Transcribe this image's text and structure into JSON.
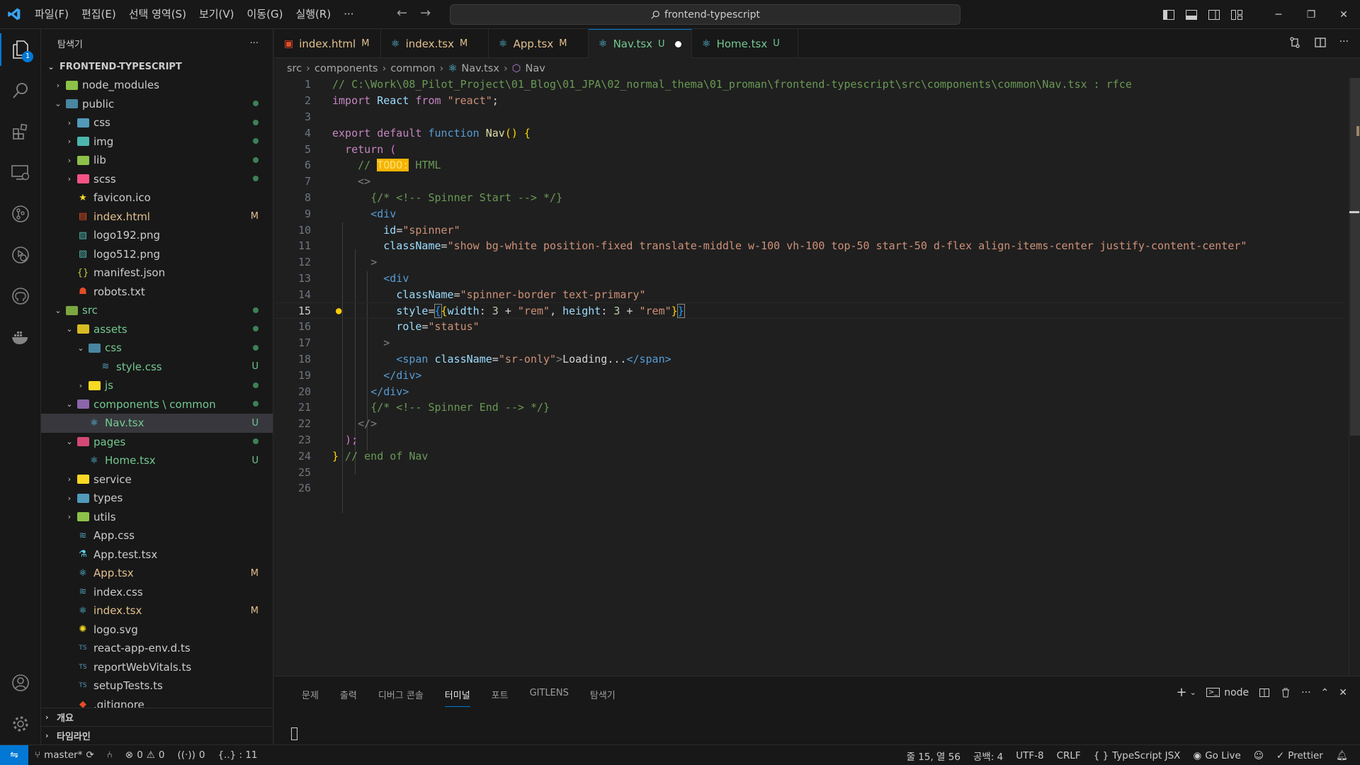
{
  "menu": [
    "파일(F)",
    "편집(E)",
    "선택 영역(S)",
    "보기(V)",
    "이동(G)",
    "실행(R)",
    "···"
  ],
  "search": {
    "text": "frontend-typescript"
  },
  "activity_badge": "1",
  "sidebar": {
    "title": "탐색기",
    "more": "···",
    "root": "FRONTEND-TYPESCRIPT",
    "outline": "개요",
    "timeline": "타임라인"
  },
  "tree": [
    {
      "label": "node_modules",
      "chev": "›",
      "status": "",
      "color": "#cccccc"
    },
    {
      "label": "public",
      "chev": "⌄",
      "status": "dot",
      "color": "#cccccc"
    },
    {
      "label": "css",
      "chev": "›",
      "status": "dot",
      "color": "#cccccc"
    },
    {
      "label": "img",
      "chev": "›",
      "status": "dot",
      "color": "#cccccc"
    },
    {
      "label": "lib",
      "chev": "›",
      "status": "dot",
      "color": "#cccccc"
    },
    {
      "label": "scss",
      "chev": "›",
      "status": "dot",
      "color": "#cccccc"
    },
    {
      "label": "favicon.ico",
      "status": "",
      "color": "#cccccc"
    },
    {
      "label": "index.html",
      "status": "M",
      "color": "#e2c08d"
    },
    {
      "label": "logo192.png",
      "status": "",
      "color": "#cccccc"
    },
    {
      "label": "logo512.png",
      "status": "",
      "color": "#cccccc"
    },
    {
      "label": "manifest.json",
      "status": "",
      "color": "#cccccc"
    },
    {
      "label": "robots.txt",
      "status": "",
      "color": "#cccccc"
    },
    {
      "label": "src",
      "chev": "⌄",
      "status": "dot",
      "color": "#73c991"
    },
    {
      "label": "assets",
      "chev": "⌄",
      "status": "dot",
      "color": "#73c991"
    },
    {
      "label": "css",
      "chev": "⌄",
      "status": "dot",
      "color": "#73c991"
    },
    {
      "label": "style.css",
      "status": "U",
      "color": "#73c991"
    },
    {
      "label": "js",
      "chev": "›",
      "status": "dot",
      "color": "#73c991"
    },
    {
      "label": "components \\ common",
      "chev": "⌄",
      "status": "dot",
      "color": "#73c991"
    },
    {
      "label": "Nav.tsx",
      "status": "U",
      "color": "#73c991"
    },
    {
      "label": "pages",
      "chev": "⌄",
      "status": "dot",
      "color": "#73c991"
    },
    {
      "label": "Home.tsx",
      "status": "U",
      "color": "#73c991"
    },
    {
      "label": "service",
      "chev": "›",
      "status": "",
      "color": "#cccccc"
    },
    {
      "label": "types",
      "chev": "›",
      "status": "",
      "color": "#cccccc"
    },
    {
      "label": "utils",
      "chev": "›",
      "status": "",
      "color": "#cccccc"
    },
    {
      "label": "App.css",
      "status": "",
      "color": "#cccccc"
    },
    {
      "label": "App.test.tsx",
      "status": "",
      "color": "#cccccc"
    },
    {
      "label": "App.tsx",
      "status": "M",
      "color": "#e2c08d"
    },
    {
      "label": "index.css",
      "status": "",
      "color": "#cccccc"
    },
    {
      "label": "index.tsx",
      "status": "M",
      "color": "#e2c08d"
    },
    {
      "label": "logo.svg",
      "status": "",
      "color": "#cccccc"
    },
    {
      "label": "react-app-env.d.ts",
      "status": "",
      "color": "#cccccc"
    },
    {
      "label": "reportWebVitals.ts",
      "status": "",
      "color": "#cccccc"
    },
    {
      "label": "setupTests.ts",
      "status": "",
      "color": "#cccccc"
    },
    {
      "label": ".gitignore",
      "status": "",
      "color": "#cccccc"
    }
  ],
  "tabs": [
    {
      "name": "index.html",
      "flag": "M",
      "color": "#e2c08d"
    },
    {
      "name": "index.tsx",
      "flag": "M",
      "color": "#e2c08d"
    },
    {
      "name": "App.tsx",
      "flag": "M",
      "color": "#e2c08d"
    },
    {
      "name": "Nav.tsx",
      "flag": "U",
      "color": "#73c991"
    },
    {
      "name": "Home.tsx",
      "flag": "U",
      "color": "#73c991"
    }
  ],
  "breadcrumb": [
    "src",
    "components",
    "common",
    "Nav.tsx",
    "Nav"
  ],
  "editor": {
    "current_line": 15,
    "line_numbers": [
      "1",
      "2",
      "3",
      "4",
      "5",
      "6",
      "7",
      "8",
      "9",
      "10",
      "11",
      "12",
      "13",
      "14",
      "15",
      "16",
      "17",
      "18",
      "19",
      "20",
      "21",
      "22",
      "23",
      "24",
      "25",
      "26"
    ],
    "l1": "// C:\\Work\\08_Pilot_Project\\01_Blog\\01_JPA\\02_normal_thema\\01_proman\\frontend-typescript\\src\\components\\common\\Nav.tsx : rfce",
    "import_kw": "import",
    "react_id": "React",
    "from_kw": "from",
    "react_str": "\"react\"",
    "semi": ";",
    "export_kw": "export",
    "default_kw": "default",
    "function_kw": "function",
    "nav_fn": "Nav",
    "fn_tail": "() {",
    "return_kw": "return",
    "paren_open": " (",
    "cmt_slash": "// ",
    "todo": "TODO:",
    "cmt_html": " HTML",
    "frag_open": "<>",
    "spinner_start": "{/* <!-- Spinner Start --> */}",
    "div_open": "<div",
    "id_attr": "id",
    "id_val": "\"spinner\"",
    "class_attr": "className",
    "class_val": "\"show bg-white position-fixed translate-middle w-100 vh-100 top-50 start-50 d-flex align-items-center justify-content-center\"",
    "gt": ">",
    "class_val2": "\"spinner-border text-primary\"",
    "style_attr": "style",
    "width_key": "width",
    "height_key": "height",
    "num3": "3",
    "rem_str": "\"rem\"",
    "role_attr": "role",
    "role_val": "\"status\"",
    "span_open": "<span",
    "class_val3": "\"sr-only\"",
    "loading": "Loading...",
    "span_close": "</span>",
    "div_close": "</div>",
    "spinner_end": "{/* <!-- Spinner End --> */}",
    "frag_close": "</>",
    "paren_close": ");",
    "end_brace": "}",
    "end_cmt": " // end of Nav"
  },
  "panel": {
    "tabs": [
      "문제",
      "출력",
      "디버그 콘솔",
      "터미널",
      "포트",
      "GITLENS",
      "탐색기"
    ],
    "active": "터미널",
    "shell": "node"
  },
  "status": {
    "branch": "master*",
    "errors": "0",
    "warnings": "0",
    "ports": "0",
    "braces": "{..} : 11",
    "position": "줄 15, 열 56",
    "spaces": "공백: 4",
    "encoding": "UTF-8",
    "eol": "CRLF",
    "lang_prefix": "{ }",
    "language": "TypeScript JSX",
    "golive": "Go Live",
    "prettier": "Prettier"
  }
}
